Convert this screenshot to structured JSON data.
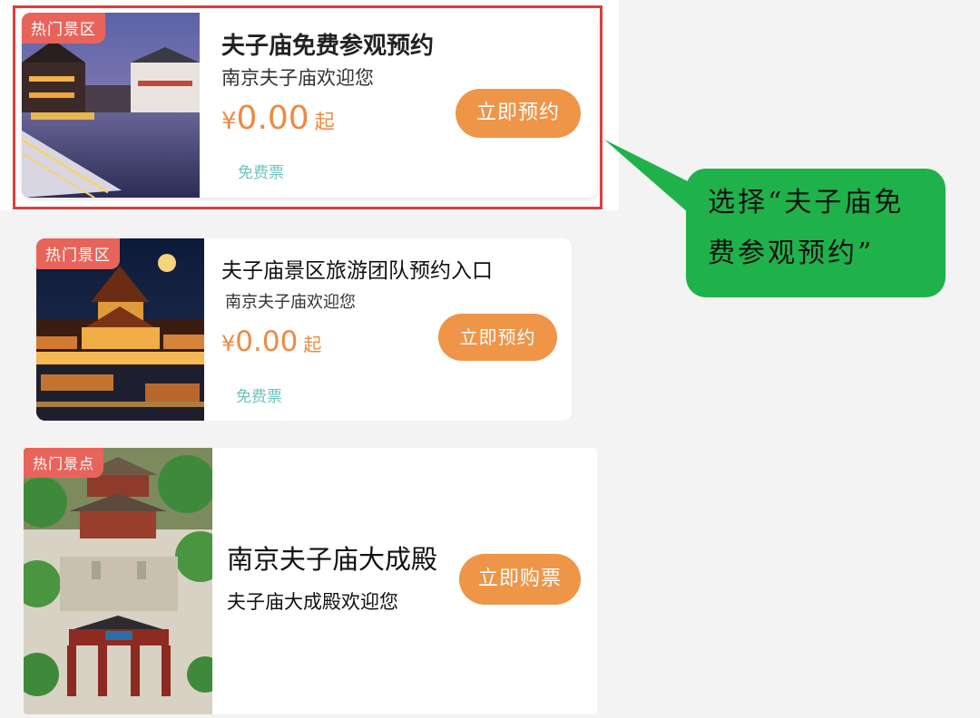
{
  "cards": [
    {
      "tag": "热门景区",
      "title": "夫子庙免费参观预约",
      "subtitle": "南京夫子庙欢迎您",
      "price_symbol": "¥",
      "price": "0.00",
      "price_suffix": "起",
      "ticket_type": "免费票",
      "button": "立即预约"
    },
    {
      "tag": "热门景区",
      "title": "夫子庙景区旅游团队预约入口",
      "subtitle": "南京夫子庙欢迎您",
      "price_symbol": "¥",
      "price": "0.00",
      "price_suffix": "起",
      "ticket_type": "免费票",
      "button": "立即预约"
    },
    {
      "tag": "热门景点",
      "title": "南京夫子庙大成殿",
      "subtitle": "夫子庙大成殿欢迎您",
      "button": "立即购票"
    }
  ],
  "annotation": {
    "text": "选择“夫子庙免费参观预约”"
  },
  "colors": {
    "accent": "#ee9548",
    "price": "#ee8a43",
    "tag": "#e8645a",
    "highlight_border": "#e03c3c",
    "callout": "#1fb24a",
    "free_ticket": "#6fc3bd"
  }
}
